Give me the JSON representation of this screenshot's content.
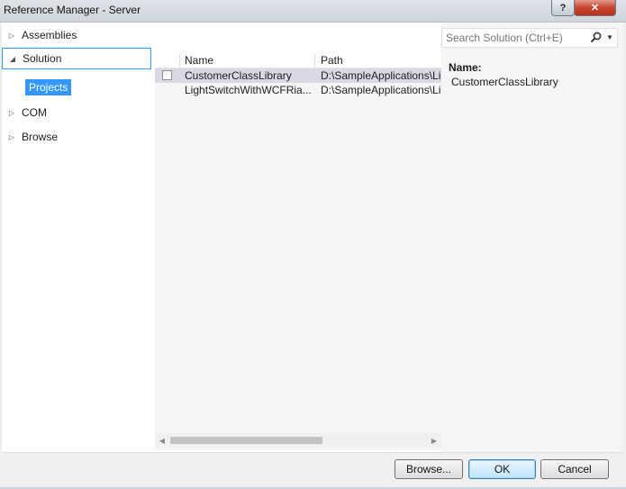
{
  "window": {
    "title": "Reference Manager - Server",
    "help_glyph": "?",
    "close_glyph": "✕"
  },
  "nav": {
    "items": [
      {
        "label": "Assemblies",
        "arrow": "▷"
      },
      {
        "label": "Solution",
        "arrow": "◢",
        "selected": true
      },
      {
        "label": "COM",
        "arrow": "▷"
      },
      {
        "label": "Browse",
        "arrow": "▷"
      }
    ],
    "sub_item": "Projects"
  },
  "list": {
    "columns": [
      "Name",
      "Path"
    ],
    "rows": [
      {
        "name": "CustomerClassLibrary",
        "path": "D:\\SampleApplications\\Li",
        "checked": false
      },
      {
        "name": "LightSwitchWithWCFRia...",
        "path": "D:\\SampleApplications\\Li",
        "checked": false
      }
    ],
    "scroll_left_glyph": "◀",
    "scroll_right_glyph": "▶"
  },
  "search": {
    "placeholder": "Search Solution (Ctrl+E)",
    "icon": "search-icon",
    "dropdown_glyph": "▼"
  },
  "details": {
    "name_label": "Name:",
    "name_value": "CustomerClassLibrary"
  },
  "buttons": {
    "browse": "Browse...",
    "ok": "OK",
    "cancel": "Cancel"
  }
}
